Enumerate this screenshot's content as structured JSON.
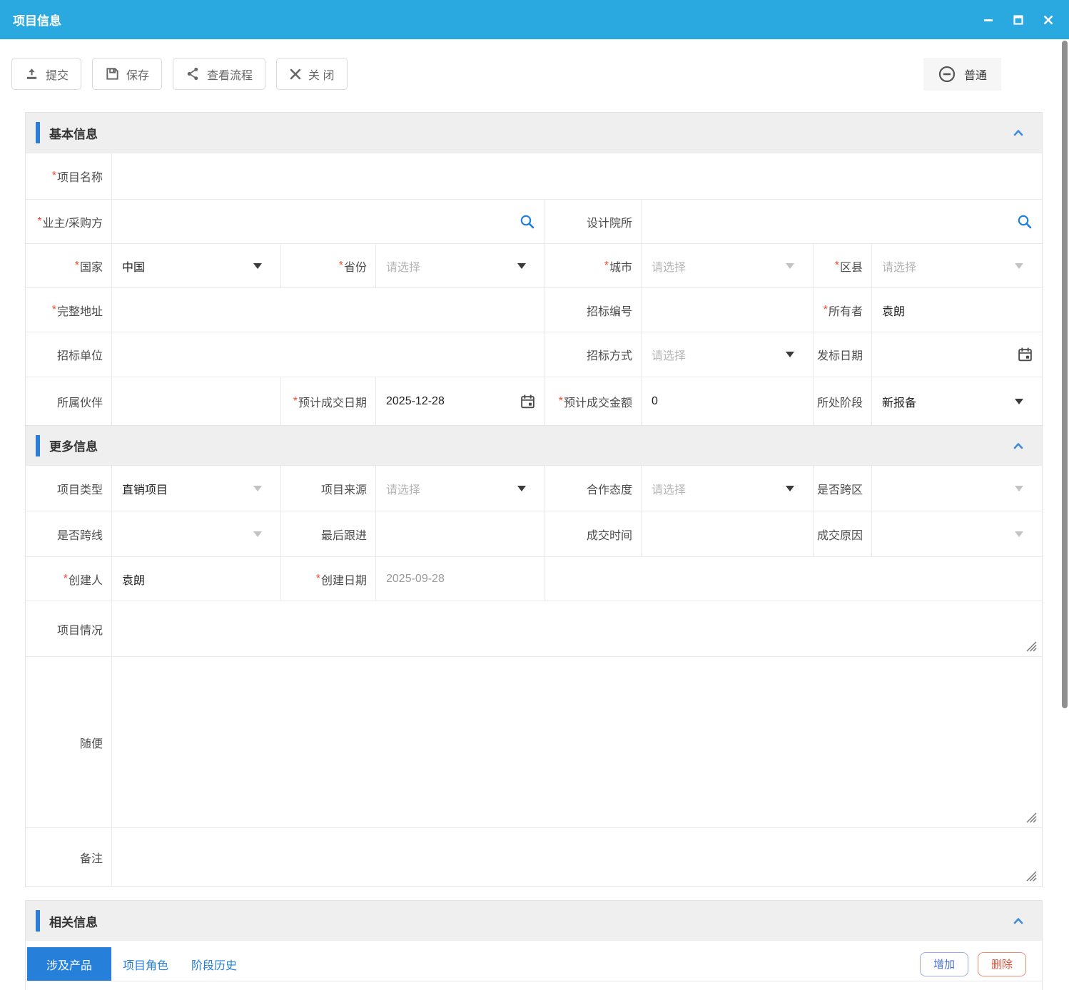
{
  "titlebar": {
    "title": "项目信息"
  },
  "toolbar": {
    "submit": "提交",
    "save": "保存",
    "view_flow": "查看流程",
    "close": "关 闭",
    "mode": "普通"
  },
  "ui": {
    "required_marker": "*"
  },
  "colors": {
    "titlebar_blue": "#29a9e0",
    "section_bar_blue": "#2d7dd2",
    "tab_active_blue": "#2680d9",
    "required_red": "#f5472c",
    "add_button_blue": "#4a6fd4",
    "delete_button_red": "#e25136"
  },
  "sections": {
    "basic": "基本信息",
    "more": "更多信息",
    "related": "相关信息"
  },
  "fields": {
    "project_name": {
      "label": "项目名称"
    },
    "owner_buyer": {
      "label": "业主/采购方"
    },
    "design_institute": {
      "label": "设计院所"
    },
    "country": {
      "label": "国家",
      "value": "中国"
    },
    "province": {
      "label": "省份",
      "placeholder": "请选择"
    },
    "city": {
      "label": "城市",
      "placeholder": "请选择"
    },
    "district": {
      "label": "区县",
      "placeholder": "请选择"
    },
    "full_address": {
      "label": "完整地址"
    },
    "bid_number": {
      "label": "招标编号"
    },
    "owner": {
      "label": "所有者",
      "value": "袁朗"
    },
    "bidding_unit": {
      "label": "招标单位"
    },
    "bidding_method": {
      "label": "招标方式",
      "placeholder": "请选择"
    },
    "issue_date": {
      "label": "发标日期"
    },
    "partner": {
      "label": "所属伙伴"
    },
    "expected_deal_date": {
      "label": "预计成交日期",
      "value": "2025-12-28"
    },
    "expected_deal_amount": {
      "label": "预计成交金额",
      "value": "0"
    },
    "current_stage": {
      "label": "所处阶段",
      "value": "新报备"
    },
    "project_type": {
      "label": "项目类型",
      "value": "直销项目"
    },
    "project_source": {
      "label": "项目来源",
      "placeholder": "请选择"
    },
    "cooperation_attitude": {
      "label": "合作态度",
      "placeholder": "请选择"
    },
    "cross_region": {
      "label": "是否跨区"
    },
    "cross_line": {
      "label": "是否跨线"
    },
    "last_follow_up": {
      "label": "最后跟进"
    },
    "deal_time": {
      "label": "成交时间"
    },
    "deal_reason": {
      "label": "成交原因"
    },
    "creator": {
      "label": "创建人",
      "value": "袁朗"
    },
    "create_date": {
      "label": "创建日期",
      "value": "2025-09-28"
    },
    "project_situation": {
      "label": "项目情况"
    },
    "casual": {
      "label": "随便"
    },
    "remarks": {
      "label": "备注"
    }
  },
  "related": {
    "tabs": [
      {
        "label": "涉及产品"
      },
      {
        "label": "项目角色"
      },
      {
        "label": "阶段历史"
      }
    ],
    "add": "增加",
    "delete": "删除"
  }
}
